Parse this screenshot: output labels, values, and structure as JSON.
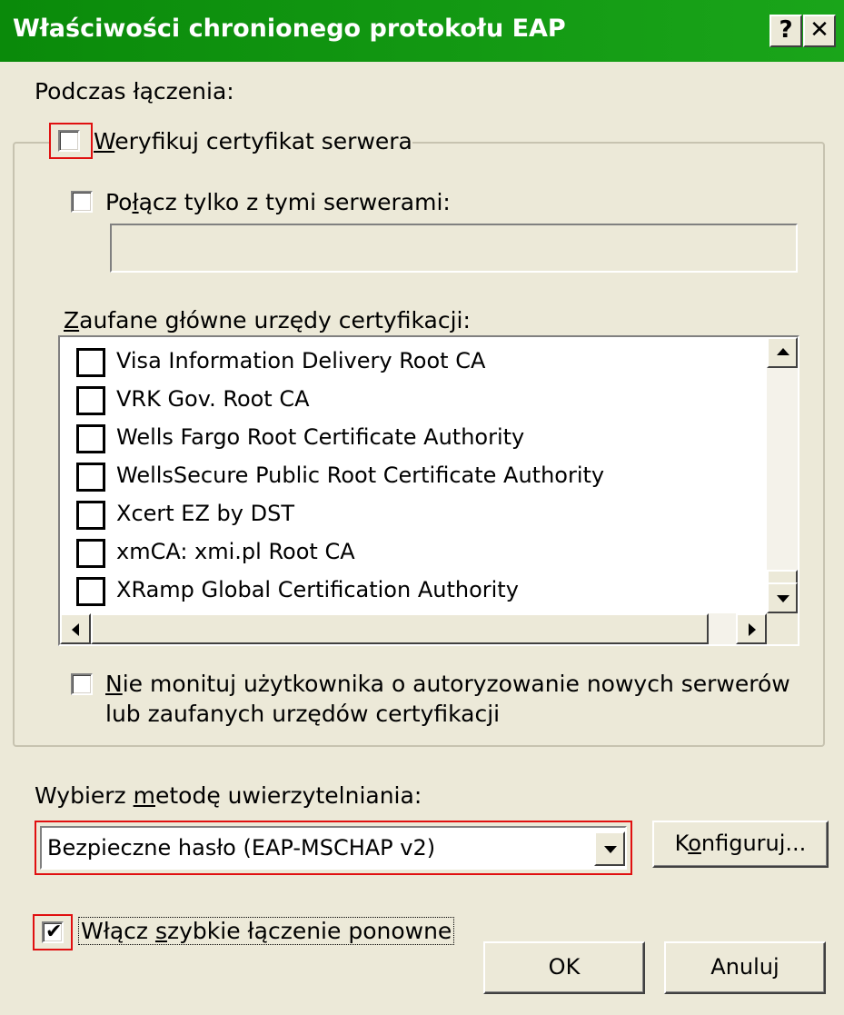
{
  "window": {
    "title": "Właściwości chronionego protokołu EAP",
    "help_button": "?",
    "close_button": "✕"
  },
  "connect_section": {
    "label": "Podczas łączenia:",
    "verify_cert": {
      "label_mnemonic": "W",
      "label_rest": "eryfikuj certyfikat serwera",
      "checked": false
    },
    "connect_only": {
      "label_pre": "Po",
      "label_mnemonic": "ł",
      "label_rest": "ącz tylko z tymi serwerami:",
      "checked": false
    },
    "servers_value": "",
    "trusted_ca_label_mnemonic": "Z",
    "trusted_ca_label_rest": "aufane główne urzędy certyfikacji:",
    "ca_list": [
      {
        "label": "Visa Information Delivery Root CA",
        "checked": false
      },
      {
        "label": "VRK Gov. Root CA",
        "checked": false
      },
      {
        "label": "Wells Fargo Root Certificate Authority",
        "checked": false
      },
      {
        "label": "WellsSecure Public Root Certificate Authority",
        "checked": false
      },
      {
        "label": "Xcert EZ by DST",
        "checked": false
      },
      {
        "label": "xmCA: xmi.pl Root CA",
        "checked": false
      },
      {
        "label": "XRamp Global Certification Authority",
        "checked": false
      }
    ],
    "no_prompt": {
      "line1_mnemonic": "N",
      "line1_rest": "ie monituj użytkownika o autoryzowanie nowych serwerów",
      "line2": "lub zaufanych urzędów certyfikacji",
      "checked": false
    }
  },
  "auth_method": {
    "label_pre": "Wybierz ",
    "label_mnemonic": "m",
    "label_rest": "etodę uwierzytelniania:",
    "selected": "Bezpieczne hasło (EAP-MSCHAP v2)",
    "configure_button_pre": "K",
    "configure_button_mnemonic": "o",
    "configure_button_rest": "nfiguruj..."
  },
  "fast_reconnect": {
    "label_pre": "Włącz ",
    "label_mnemonic": "s",
    "label_rest": "zybkie łączenie ponowne",
    "checked": true
  },
  "footer": {
    "ok_label": "OK",
    "cancel_label": "Anuluj"
  },
  "colors": {
    "titlebar": "#0a8a0a",
    "dialog_bg": "#ece9d8",
    "highlight_box": "#e01010"
  }
}
